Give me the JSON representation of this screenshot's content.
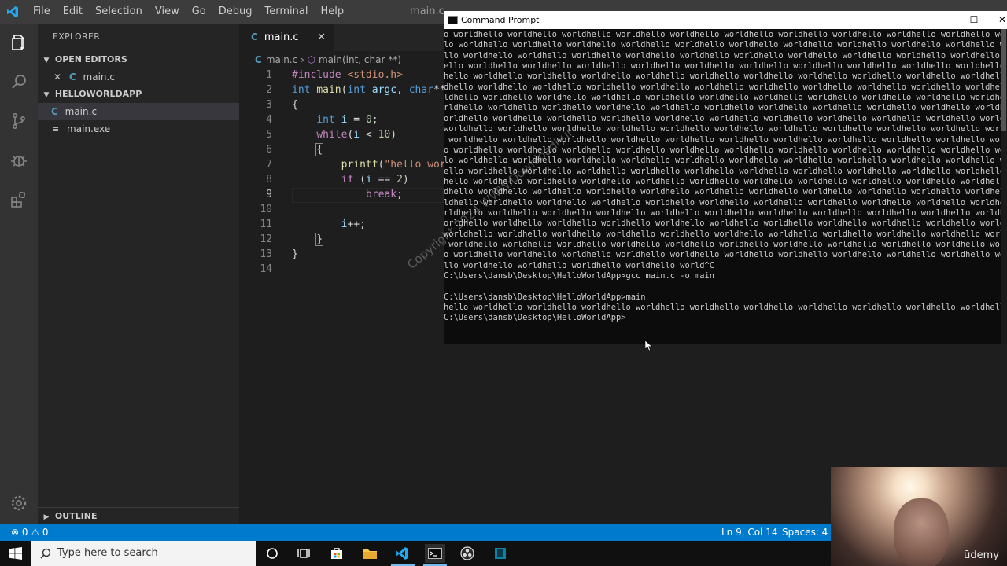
{
  "vscode": {
    "menu": [
      "File",
      "Edit",
      "Selection",
      "View",
      "Go",
      "Debug",
      "Terminal",
      "Help"
    ],
    "window_title": "main.c"
  },
  "sidebar": {
    "title": "EXPLORER",
    "open_editors_label": "OPEN EDITORS",
    "open_editor_file": "main.c",
    "folder_label": "HELLOWORLDAPP",
    "files": [
      "main.c",
      "main.exe"
    ],
    "outline_label": "OUTLINE"
  },
  "editor": {
    "tab_label": "main.c",
    "tab_icon": "C",
    "breadcrumb_file": "main.c",
    "breadcrumb_symbol": "main(int, char **)",
    "line_numbers": [
      "1",
      "2",
      "3",
      "4",
      "5",
      "6",
      "7",
      "8",
      "9",
      "10",
      "11",
      "12",
      "13",
      "14"
    ]
  },
  "status": {
    "errors": "0",
    "warnings": "0",
    "position": "Ln 9, Col 14",
    "spaces": "Spaces: 4"
  },
  "cmd": {
    "title": "Command Prompt",
    "minimize": "—",
    "maximize": "☐",
    "close": "✕",
    "lines": [
      "o worldhello worldhello worldhello worldhello worldhello worldhello worldhello worldhello worldhello worldhello worldhello world",
      "lo worldhello worldhello worldhello worldhello worldhello worldhello worldhello worldhello worldhello worldhello worldhello worl",
      "llo worldhello worldhello worldhello worldhello worldhello worldhello worldhello worldhello worldhello worldhello worldhello wor",
      "ello worldhello worldhello worldhello worldhello worldhello worldhello worldhello worldhello worldhello worldhello worldhello wo",
      "hello worldhello worldhello worldhello worldhello worldhello worldhello worldhello worldhello worldhello worldhello worldhello w",
      "dhello worldhello worldhello worldhello worldhello worldhello worldhello worldhello worldhello worldhello worldhello worldhello ",
      "ldhello worldhello worldhello worldhello worldhello worldhello worldhello worldhello worldhello worldhello worldhello worldhello",
      "rldhello worldhello worldhello worldhello worldhello worldhello worldhello worldhello worldhello worldhello worldhello worldhell",
      "orldhello worldhello worldhello worldhello worldhello worldhello worldhello worldhello worldhello worldhello worldhello worldhel",
      "worldhello worldhello worldhello worldhello worldhello worldhello worldhello worldhello worldhello worldhello worldhello worldhe",
      " worldhello worldhello worldhello worldhello worldhello worldhello worldhello worldhello worldhello worldhello worldhello worldh",
      "o worldhello worldhello worldhello worldhello worldhello worldhello worldhello worldhello worldhello worldhello worldhello world",
      "lo worldhello worldhello worldhello worldhello worldhello worldhello worldhello worldhello worldhello worldhello worldhello worl",
      "ello worldhello worldhello worldhello worldhello worldhello worldhello worldhello worldhello worldhello worldhello worldhello wo",
      "hello worldhello worldhello worldhello worldhello worldhello worldhello worldhello worldhello worldhello worldhello worldhello w",
      "dhello worldhello worldhello worldhello worldhello worldhello worldhello worldhello worldhello worldhello worldhello worldhello ",
      "ldhello worldhello worldhello worldhello worldhello worldhello worldhello worldhello worldhello worldhello worldhello worldhello",
      "rldhello worldhello worldhello worldhello worldhello worldhello worldhello worldhello worldhello worldhello worldhello worldhell",
      "orldhello worldhello worldhello worldhello worldhello worldhello worldhello worldhello worldhello worldhello worldhello worldhel",
      "worldhello worldhello worldhello worldhello worldhello worldhello worldhello worldhello worldhello worldhello worldhello worldhe",
      " worldhello worldhello worldhello worldhello worldhello worldhello worldhello worldhello worldhello worldhello worldhello worldh",
      "o worldhello worldhello worldhello worldhello worldhello worldhello worldhello worldhello worldhello worldhello worldhello world",
      "llo worldhello worldhello worldhello worldhello world^C",
      "C:\\Users\\dansb\\Desktop\\HelloWorldApp>gcc main.c -o main",
      "",
      "C:\\Users\\dansb\\Desktop\\HelloWorldApp>main",
      "hello worldhello worldhello worldhello worldhello worldhello worldhello worldhello worldhello worldhello worldhello world",
      "C:\\Users\\dansb\\Desktop\\HelloWorldApp>"
    ]
  },
  "taskbar": {
    "search_placeholder": "Type here to search"
  },
  "webcam": {
    "brand": "ūdemy"
  },
  "watermark": "Copyright 2024 WWW.Downloadly.ir",
  "colors": {
    "statusbar": "#007acc",
    "activitybar": "#333333",
    "sidebar": "#252526",
    "editor": "#1e1e1e",
    "cmd_background": "#0c0c0c"
  }
}
